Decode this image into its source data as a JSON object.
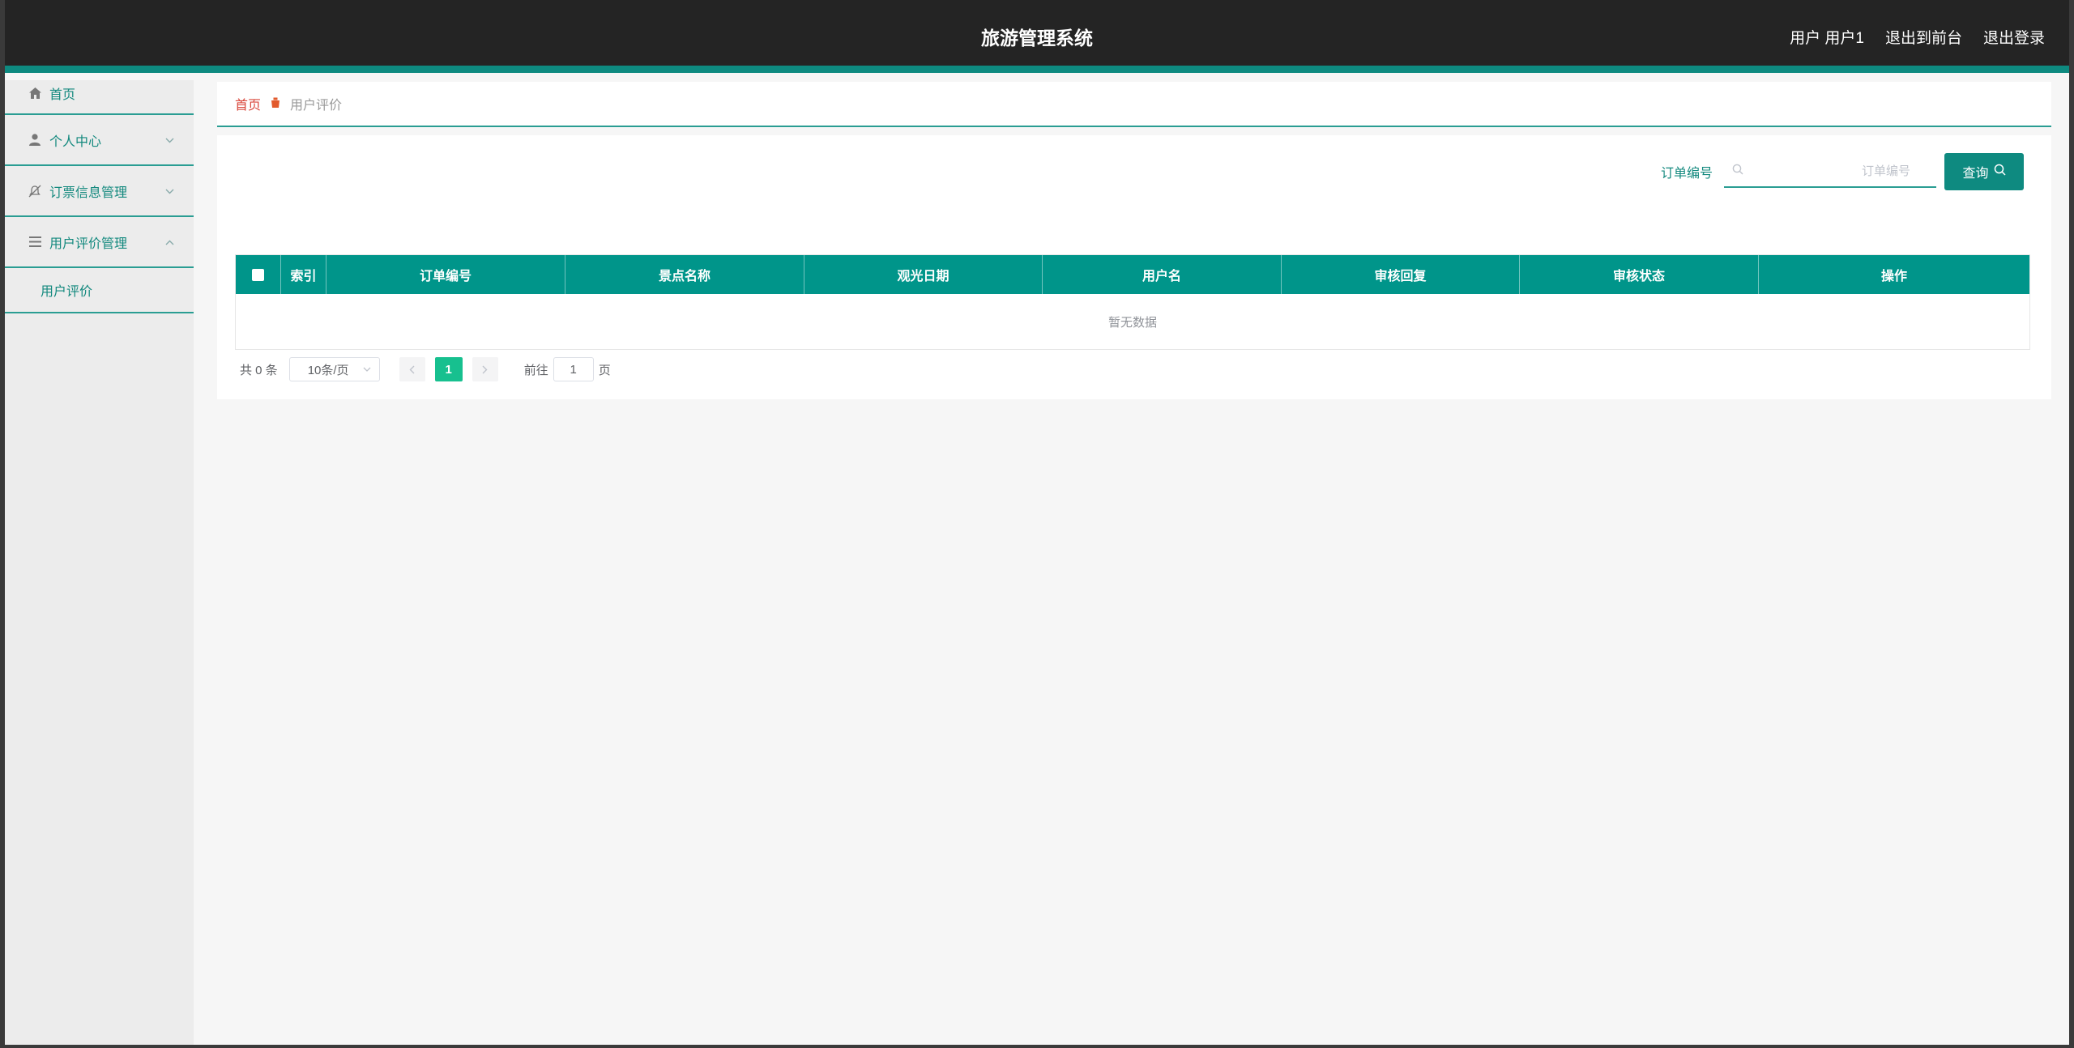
{
  "header": {
    "title": "旅游管理系统",
    "user_label": "用户 用户1",
    "to_front_label": "退出到前台",
    "logout_label": "退出登录"
  },
  "sidebar": {
    "items": [
      {
        "label": "首页",
        "icon": "home-icon"
      },
      {
        "label": "个人中心",
        "icon": "user-icon",
        "expanded": false
      },
      {
        "label": "订票信息管理",
        "icon": "bell-off-icon",
        "expanded": false
      },
      {
        "label": "用户评价管理",
        "icon": "menu-icon",
        "expanded": true
      }
    ],
    "submenu": [
      {
        "label": "用户评价"
      }
    ]
  },
  "breadcrumb": {
    "home": "首页",
    "current": "用户评价"
  },
  "search": {
    "label": "订单编号",
    "placeholder": "订单编号",
    "button_label": "查询"
  },
  "table": {
    "columns": [
      "索引",
      "订单编号",
      "景点名称",
      "观光日期",
      "用户名",
      "审核回复",
      "审核状态",
      "操作"
    ],
    "rows": [],
    "empty_text": "暂无数据"
  },
  "pagination": {
    "total_text": "共 0 条",
    "page_size": "10条/页",
    "current_page": "1",
    "goto_label": "前往",
    "goto_value": "1",
    "page_suffix": "页"
  },
  "colors": {
    "accent": "#00958a",
    "topbar": "#242424",
    "active_page": "#17c08f",
    "breadcrumb_home": "#d9463a"
  }
}
